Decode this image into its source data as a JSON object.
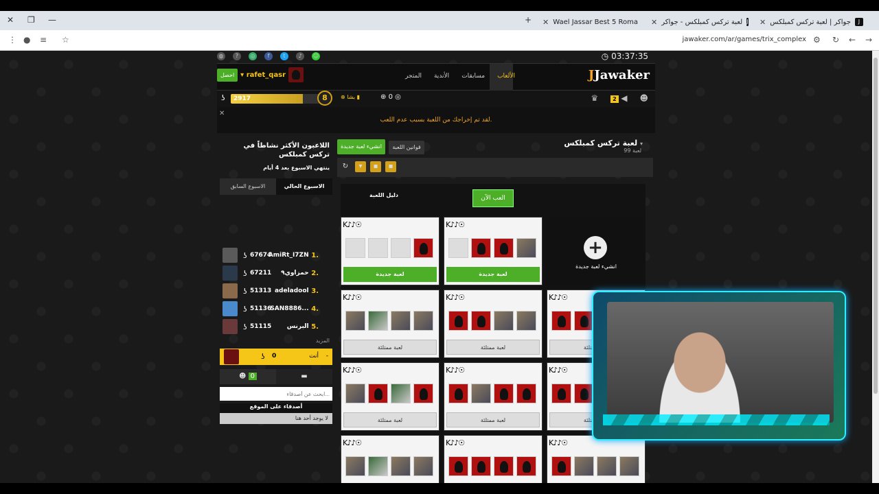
{
  "browser": {
    "tabs": [
      {
        "title": "جواكر | لعبة تركس كمبلكس",
        "active": true
      },
      {
        "title": "لعبة تركس كمبلكس - جواكر",
        "active": false
      },
      {
        "title": "Wael Jassar Best 5 Roma",
        "active": false
      }
    ],
    "url": "jawaker.com/ar/games/trix_complex"
  },
  "site": {
    "logo": "Jawaker",
    "timer": "03:37:35",
    "nav": [
      {
        "label": "الألعاب",
        "active": true
      },
      {
        "label": "مسابقات",
        "active": false
      },
      {
        "label": "الأندية",
        "active": false
      },
      {
        "label": "المتجر",
        "active": false
      }
    ],
    "user": {
      "name": "rafet_qasr",
      "get_label": "احصل"
    },
    "stats": {
      "coins": "2917",
      "level": "8",
      "bonus": "بشا",
      "chips": "0",
      "rank_badge": "2",
      "progress_fraction": 0.72
    },
    "notice": "لقد تم إخراجك من اللعبة بسبب عدم اللعب."
  },
  "sidebar": {
    "title": "اللاعبون الأكثر نشاطاً في تركس كمبلكس",
    "subtitle": "ينتهي الاسبوع بعد 4 أيام",
    "tabs": [
      "الاسبوع الحالي",
      "الاسبوع السابق"
    ],
    "leaders": [
      {
        "rank": "1.",
        "name": "AmiRt_I7ZN",
        "score": "67674",
        "jsym": "ʖ"
      },
      {
        "rank": "2.",
        "name": "حمزاوي٩",
        "score": "67211",
        "jsym": "ʖ"
      },
      {
        "rank": "3.",
        "name": "adeladool",
        "score": "51313",
        "jsym": "ʖ"
      },
      {
        "rank": "4.",
        "name": "SAN8886...",
        "score": "51136",
        "jsym": "ʖ"
      },
      {
        "rank": "5.",
        "name": "ألبرنس",
        "score": "51115",
        "jsym": "ʖ"
      }
    ],
    "more": "المزيد",
    "you": {
      "label": "أنت",
      "score": "0",
      "jsym": "ʖ"
    },
    "friends_count": "0",
    "search_placeholder": "ابحث عن أصدقاء...",
    "on_site": "أصدقاء على الموقع",
    "no_friends": "لا يوجد أحد هنا"
  },
  "main": {
    "title": "لعبة تركس كمبلكس",
    "subtitle": "99 لعبة",
    "new_game": "انشيء لعبة جديدة",
    "rules": "قوانين اللعبة",
    "guide": "دليل اللعبة",
    "play_now": "العب الآن",
    "create_label": "انشيء لعبة جديدة",
    "card_symbols": "K♪♪☉",
    "new_game_btn": "لعبة جديدة",
    "full_btn": "لعبة ممتلئة"
  }
}
